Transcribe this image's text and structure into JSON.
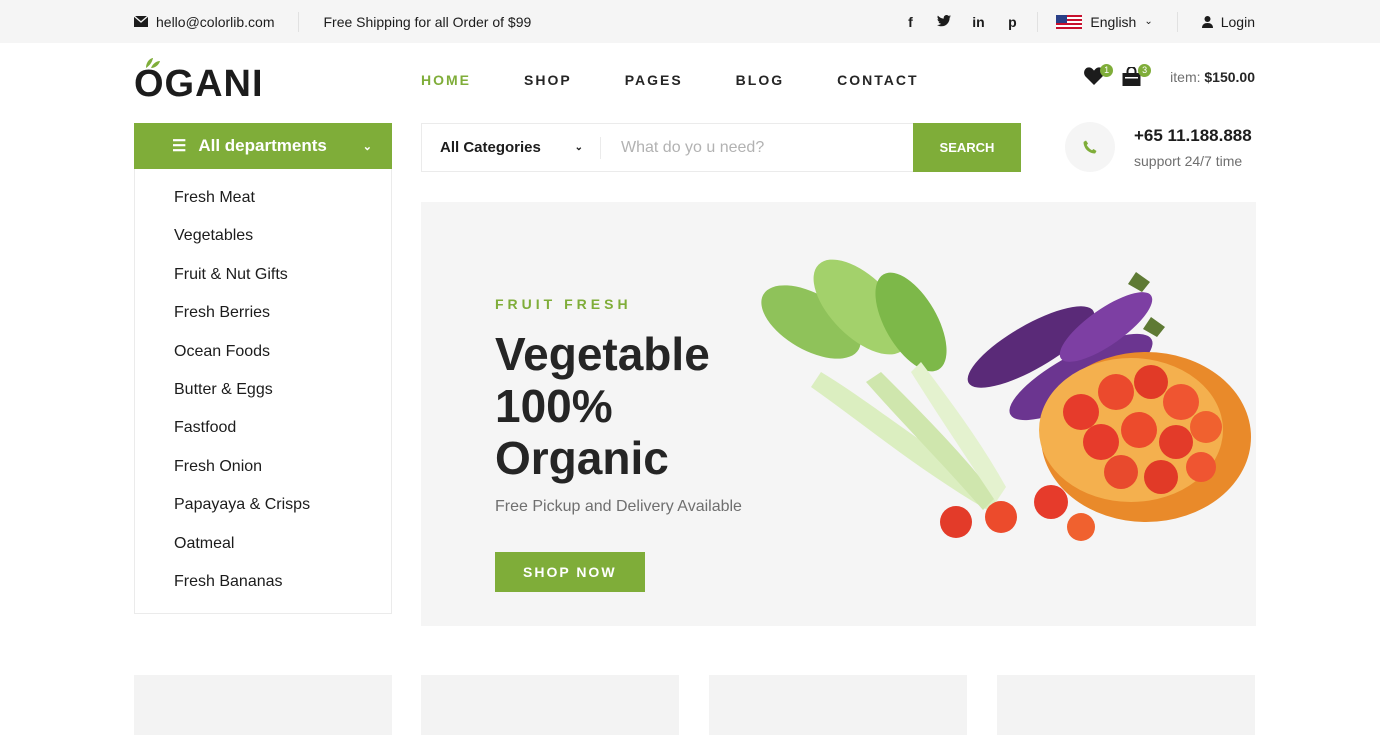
{
  "topbar": {
    "email": "hello@colorlib.com",
    "shipping": "Free Shipping for all Order of $99",
    "socials": [
      "f",
      "t",
      "in",
      "p"
    ],
    "language": "English",
    "login": "Login"
  },
  "logo": "OGANI",
  "nav": [
    "HOME",
    "SHOP",
    "PAGES",
    "BLOG",
    "CONTACT"
  ],
  "cart": {
    "wishlist_count": "1",
    "cart_count": "3",
    "item_label": "item:",
    "item_total": "$150.00"
  },
  "departments": {
    "title": "All departments",
    "items": [
      "Fresh Meat",
      "Vegetables",
      "Fruit & Nut Gifts",
      "Fresh Berries",
      "Ocean Foods",
      "Butter & Eggs",
      "Fastfood",
      "Fresh Onion",
      "Papayaya & Crisps",
      "Oatmeal",
      "Fresh Bananas"
    ]
  },
  "search": {
    "category": "All Categories",
    "placeholder": "What do yo u need?",
    "button": "SEARCH"
  },
  "contact": {
    "phone": "+65 11.188.888",
    "support": "support 24/7 time"
  },
  "hero": {
    "kicker": "FRUIT FRESH",
    "title": "Vegetable 100% Organic",
    "subtitle": "Free Pickup and Delivery Available",
    "button": "SHOP NOW"
  },
  "colors": {
    "accent": "#7fad39",
    "text": "#1c1c1c",
    "muted": "#6f6f6f",
    "panel": "#f5f5f5"
  },
  "icons": [
    "envelope-icon",
    "facebook-icon",
    "twitter-icon",
    "linkedin-icon",
    "pinterest-icon",
    "flag-icon",
    "user-icon",
    "heart-icon",
    "shopping-bag-icon",
    "menu-icon",
    "chevron-down-icon",
    "phone-icon",
    "leaf-icon"
  ]
}
